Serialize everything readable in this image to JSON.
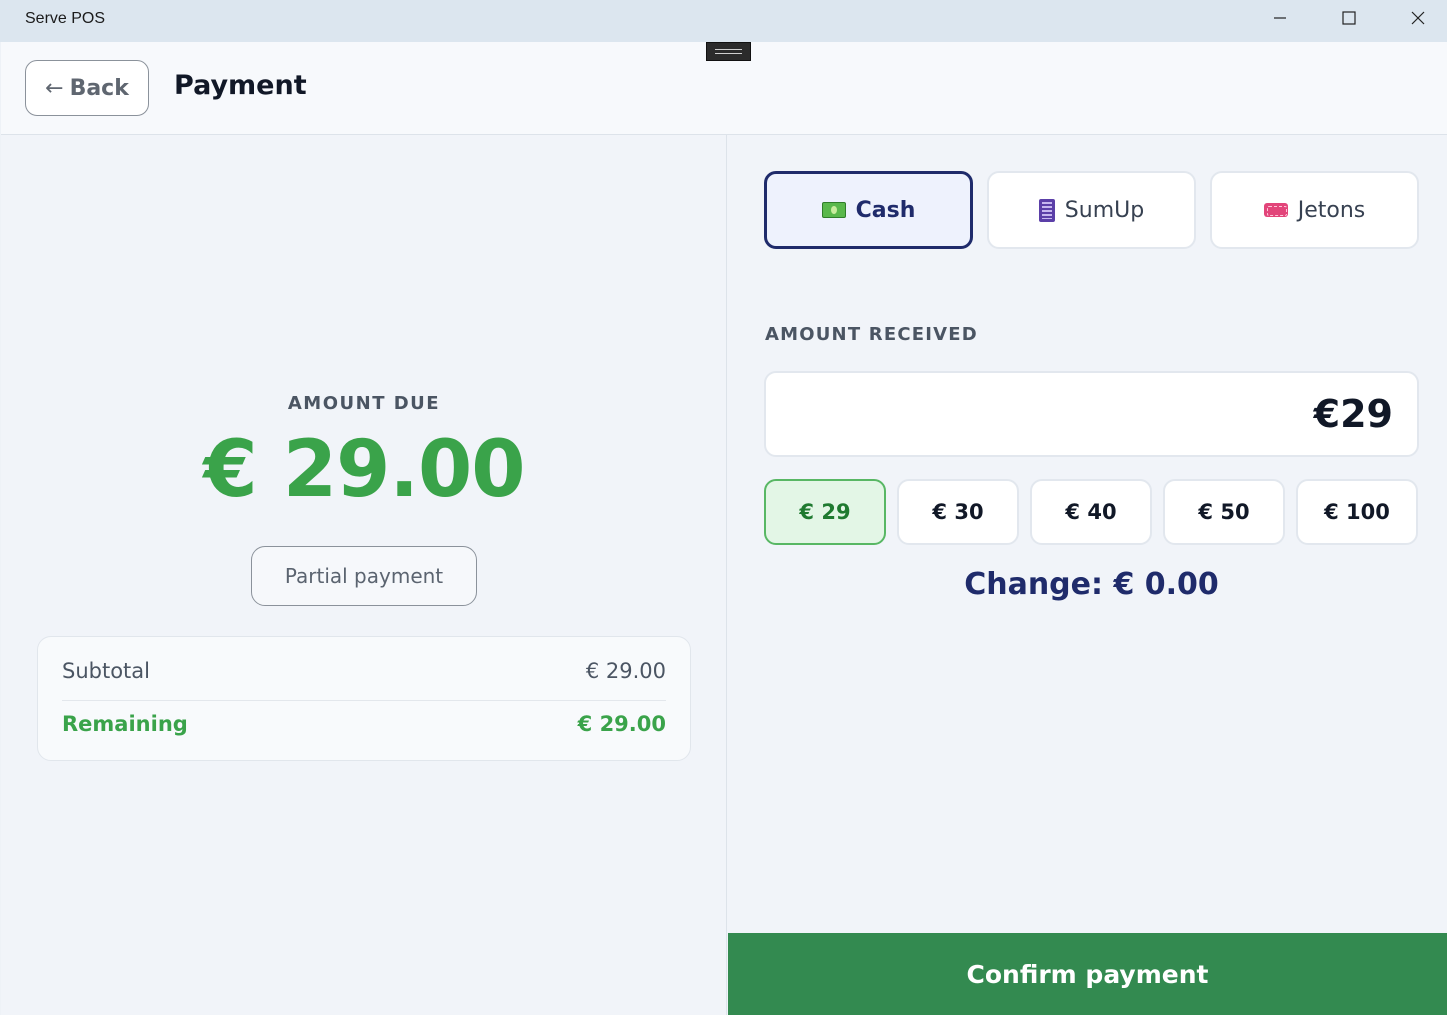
{
  "window": {
    "title": "Serve POS",
    "controls": [
      "minimize-icon",
      "maximize-icon",
      "close-icon"
    ]
  },
  "header": {
    "back_arrow": "←",
    "back_label": "Back",
    "title": "Payment"
  },
  "amount_due": {
    "label": "AMOUNT DUE",
    "value": "€ 29.00"
  },
  "partial_payment_label": "Partial payment",
  "summary": {
    "subtotal_label": "Subtotal",
    "subtotal_value": "€ 29.00",
    "remaining_label": "Remaining",
    "remaining_value": "€ 29.00"
  },
  "methods": [
    {
      "label": "Cash",
      "icon": "cash-icon",
      "active": true
    },
    {
      "label": "SumUp",
      "icon": "card-terminal-icon",
      "active": false
    },
    {
      "label": "Jetons",
      "icon": "ticket-icon",
      "active": false
    }
  ],
  "amount_received": {
    "label": "AMOUNT RECEIVED",
    "value": "€29"
  },
  "quick_amounts": [
    {
      "label": "€ 29",
      "active": true
    },
    {
      "label": "€ 30",
      "active": false
    },
    {
      "label": "€ 40",
      "active": false
    },
    {
      "label": "€ 50",
      "active": false
    },
    {
      "label": "€ 100",
      "active": false
    }
  ],
  "change_text": "Change: € 0.00",
  "confirm_label": "Confirm payment",
  "colors": {
    "accent_green": "#3aa34a",
    "confirm_green": "#338a50",
    "navy": "#1f2b6b"
  }
}
